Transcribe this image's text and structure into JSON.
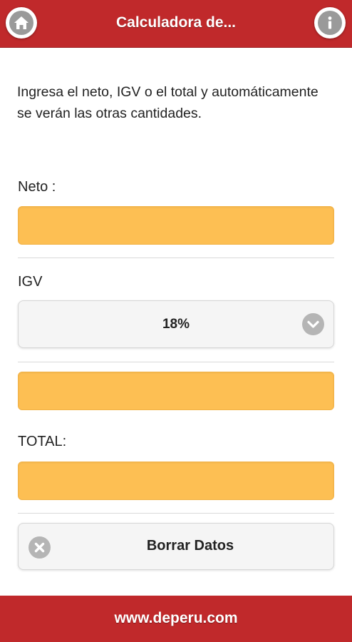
{
  "header": {
    "title": "Calculadora de...",
    "home_icon": "home-icon",
    "info_icon": "info-icon"
  },
  "intro": {
    "text": "Ingresa el neto, IGV o el total y automáticamente se verán las otras cantidades."
  },
  "form": {
    "neto_label": "Neto :",
    "neto_value": "",
    "igv_label": "IGV",
    "igv_rate": "18%",
    "igv_value": "",
    "total_label": "TOTAL:",
    "total_value": ""
  },
  "actions": {
    "clear_label": "Borrar Datos",
    "clear_icon": "close-circle-icon"
  },
  "footer": {
    "text": "www.deperu.com"
  },
  "colors": {
    "brand_red": "#c0292b",
    "field_orange": "#fdbf53",
    "icon_gray": "#b5b5b5"
  }
}
